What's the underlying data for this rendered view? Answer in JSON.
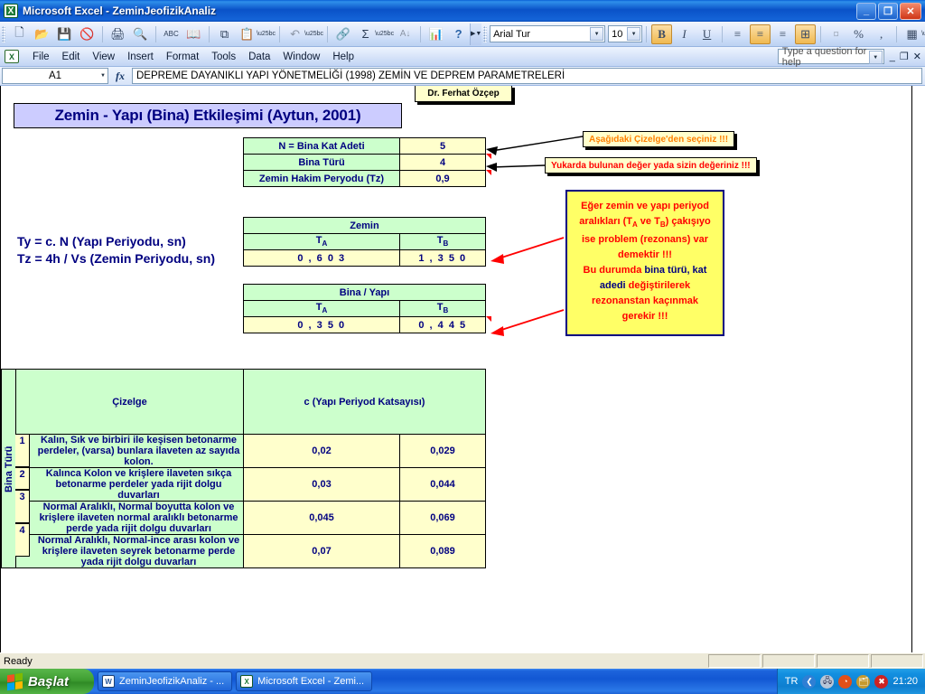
{
  "window": {
    "title": "Microsoft Excel - ZeminJeofizikAnaliz",
    "app_icon": "excel-icon",
    "minimize": "_",
    "restore": "❐",
    "close": "✕"
  },
  "menubar": {
    "items": [
      "File",
      "Edit",
      "View",
      "Insert",
      "Format",
      "Tools",
      "Data",
      "Window",
      "Help"
    ],
    "help_placeholder": "Type a question for help",
    "doc_minimize": "_",
    "doc_restore": "❐",
    "doc_close": "✕"
  },
  "toolbar": {
    "standard": [
      {
        "name": "new-icon",
        "glyph": "🗋"
      },
      {
        "name": "open-icon",
        "glyph": "📂"
      },
      {
        "name": "save-icon",
        "glyph": "💾"
      },
      {
        "name": "permission-icon",
        "glyph": "🚫"
      },
      {
        "name": "print-icon",
        "glyph": "🖨"
      },
      {
        "name": "print-preview-icon",
        "glyph": "🔍"
      },
      {
        "name": "spelling-icon",
        "glyph": "ABC"
      },
      {
        "name": "research-icon",
        "glyph": "📖"
      },
      {
        "name": "copy-icon",
        "glyph": "⧉"
      },
      {
        "name": "paste-icon",
        "glyph": "📋"
      },
      {
        "name": "undo-icon",
        "glyph": "↶"
      },
      {
        "name": "hyperlink-icon",
        "glyph": "🔗"
      },
      {
        "name": "autosum-icon",
        "glyph": "Σ"
      },
      {
        "name": "sort-ascending-icon",
        "glyph": "A↓"
      },
      {
        "name": "chart-wizard-icon",
        "glyph": "📊"
      },
      {
        "name": "help-icon",
        "glyph": "?"
      }
    ],
    "font_name": "Arial Tur",
    "font_size": "10",
    "bold_label": "B",
    "italic_label": "I",
    "underline_label": "U",
    "align_left": "≡",
    "align_center": "≡",
    "align_right": "≡",
    "merge_center": "⊞",
    "currency": "¤",
    "percent": "%",
    "comma": ",",
    "borders": "▦",
    "fill_color": "🎨",
    "font_color": "A",
    "overflow": "»"
  },
  "formulabar": {
    "name_box": "A1",
    "fx_label": "fx",
    "formula_text": "DEPREME DAYANIKLI YAPI YÖNETMELİĞİ (1998) ZEMİN VE DEPREM PARAMETRELERİ"
  },
  "sheet": {
    "banner_title": "Zemin - Yapı (Bina) Etkileşimi (Aytun, 2001)",
    "author_tag": "Dr. Ferhat Özçep",
    "formula_line_1": "Ty =  c. N    (Yapı Periyodu, sn)",
    "formula_line_2": "Tz = 4h / Vs (Zemin Periyodu, sn)",
    "input_table": {
      "rows": [
        {
          "label": "N = Bina Kat Adeti",
          "value": "5"
        },
        {
          "label": "Bina Türü",
          "value": "4"
        },
        {
          "label": "Zemin Hakim Peryodu (Tz)",
          "value": "0,9"
        }
      ]
    },
    "zemin_table": {
      "header": "Zemin",
      "col_a": "T",
      "col_a_sub": "A",
      "col_b": "T",
      "col_b_sub": "B",
      "val_a": "0 , 6 0 3",
      "val_b": "1 , 3 5 0"
    },
    "bina_table": {
      "header": "Bina / Yapı",
      "col_a": "T",
      "col_a_sub": "A",
      "col_b": "T",
      "col_b_sub": "B",
      "val_a": "0 , 3 5 0",
      "val_b": "0 , 4 4 5"
    },
    "callouts": {
      "callout_1": "Aşağıdaki Çizelge'den seçiniz !!!",
      "callout_2": "Yukarda bulunan değer yada sizin değeriniz !!!"
    },
    "note_box": {
      "line1": "Eğer zemin ve yapı periyod",
      "line2_pre": "aralıkları (T",
      "line2_suba": "A",
      "line2_mid": " ve T",
      "line2_subb": "B",
      "line2_post": ") çakışıyo",
      "line3": "ise problem (rezonans) var",
      "line4": "demektir !!!",
      "line5a": "Bu durumda ",
      "line5b": "bina türü, kat",
      "line6a": "adedi ",
      "line6b": "değiştirilerek",
      "line7": "rezonanstan kaçınmak",
      "line8": "gerekir !!!"
    },
    "cizelge_table": {
      "vertical_header": "Bina Türü",
      "col_desc": "Çizelge",
      "col_coef": "c (Yapı Periyod Katsayısı)",
      "rows": [
        {
          "index": "1",
          "desc": "Kalın, Sık ve birbiri ile keşisen betonarme perdeler, (varsa) bunlara ilaveten az sayıda kolon.",
          "c1": "0,02",
          "c2": "0,029"
        },
        {
          "index": "2",
          "desc": "Kalınca Kolon ve krişlere ilaveten sıkça betonarme perdeler yada rijit dolgu duvarları",
          "c1": "0,03",
          "c2": "0,044"
        },
        {
          "index": "3",
          "desc": "Normal Aralıklı, Normal boyutta kolon ve krişlere ilaveten normal aralıklı betonarme perde yada rijit dolgu duvarları",
          "c1": "0,045",
          "c2": "0,069"
        },
        {
          "index": "4",
          "desc": "Normal Aralıklı, Normal-ince arası kolon ve krişlere ilaveten seyrek betonarme perde yada rijit dolgu duvarları",
          "c1": "0,07",
          "c2": "0,089"
        }
      ]
    }
  },
  "statusbar": {
    "status": "Ready"
  },
  "taskbar": {
    "start_label": "Başlat",
    "items": [
      {
        "name": "taskbar-item-word",
        "label": "ZeminJeofizikAnaliz - ...",
        "icon": "word-icon",
        "glyph": "W"
      },
      {
        "name": "taskbar-item-excel",
        "label": "Microsoft Excel - Zemi...",
        "icon": "excel-icon",
        "glyph": "X"
      }
    ],
    "language": "TR",
    "clock": "21:20",
    "tray_icons": [
      {
        "name": "messenger-icon",
        "glyph": "❮",
        "color": "#2f7fd4"
      },
      {
        "name": "network-icon",
        "glyph": "🖧",
        "color": "#b8c6d8"
      },
      {
        "name": "browser-icon",
        "glyph": "◔",
        "color": "#e2501a"
      },
      {
        "name": "folder-icon",
        "glyph": "🗂",
        "color": "#c79a2e"
      },
      {
        "name": "security-icon",
        "glyph": "✖",
        "color": "#cc2222"
      }
    ]
  },
  "colors": {
    "banner_bg": "#ccccff",
    "header_green": "#ccffcc",
    "value_yellow": "#ffffcc",
    "note_yellow": "#ffff66",
    "navy_text": "#000080",
    "red_text": "#ff0000",
    "orange_text": "#ff8000"
  }
}
